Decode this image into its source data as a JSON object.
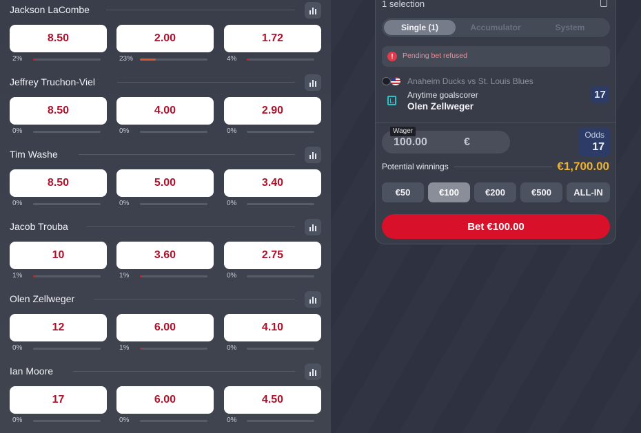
{
  "markets": [
    {
      "player": "Jackson LaCombe",
      "odds": [
        "8.50",
        "2.00",
        "1.72"
      ],
      "percents": [
        "2%",
        "23%",
        "4%"
      ],
      "share": [
        0.02,
        0.23,
        0.04
      ]
    },
    {
      "player": "Jeffrey Truchon-Viel",
      "odds": [
        "8.50",
        "4.00",
        "2.90"
      ],
      "percents": [
        "0%",
        "0%",
        "0%"
      ],
      "share": [
        0,
        0,
        0
      ]
    },
    {
      "player": "Tim Washe",
      "odds": [
        "8.50",
        "5.00",
        "3.40"
      ],
      "percents": [
        "0%",
        "0%",
        "0%"
      ],
      "share": [
        0,
        0,
        0
      ]
    },
    {
      "player": "Jacob Trouba",
      "odds": [
        "10",
        "3.60",
        "2.75"
      ],
      "percents": [
        "1%",
        "1%",
        "0%"
      ],
      "share": [
        0.01,
        0.01,
        0
      ]
    },
    {
      "player": "Olen Zellweger",
      "odds": [
        "12",
        "6.00",
        "4.10"
      ],
      "percents": [
        "0%",
        "1%",
        "0%"
      ],
      "share": [
        0,
        0.01,
        0
      ]
    },
    {
      "player": "Ian Moore",
      "odds": [
        "17",
        "6.00",
        "4.50"
      ],
      "percents": [
        "0%",
        "0%",
        "0%"
      ],
      "share": [
        0,
        0,
        0
      ]
    }
  ],
  "colors": {
    "bar_fill": "#e0582a",
    "bar_fill_small": "#d81c2e",
    "odds_text": "#b0102a",
    "accent_red": "#d8102a",
    "winnings": "#f0b232"
  },
  "betslip": {
    "title": "1 selection",
    "tabs": [
      "Single (1)",
      "Accumulator",
      "System"
    ],
    "active_tab": 0,
    "refused_message": "Pending bet refused",
    "alert_symbol": "!",
    "match": "Anaheim Ducks vs St. Louis Blues",
    "market": "Anytime goalscorer",
    "selection": "Olen Zellweger",
    "selection_odds": "17",
    "wager_label": "Wager",
    "wager_value": "100.00",
    "currency": "€",
    "odds_label": "Odds",
    "odds_value": "17",
    "winnings_label": "Potential winnings",
    "winnings_value": "€1,700.00",
    "stakes": [
      "€50",
      "€100",
      "€200",
      "€500",
      "ALL-IN"
    ],
    "active_stake": 1,
    "bet_button": "Bet €100.00"
  }
}
